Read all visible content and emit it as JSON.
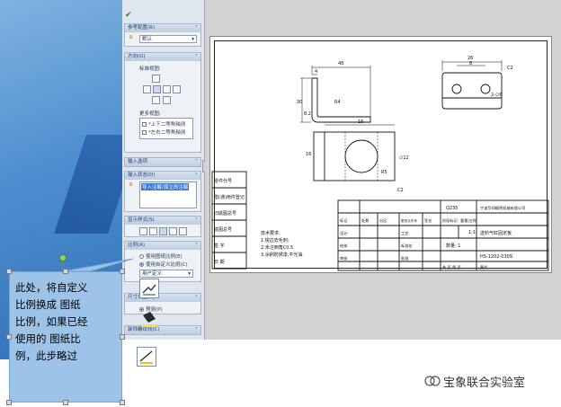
{
  "property_manager": {
    "groups": {
      "reference_config": "参考配置(R)",
      "orientation": "方向(O)",
      "import_options": "输入选项",
      "import_state": "输入状态(D)",
      "display_style": "显示样式(S)",
      "scale": "比例(A)",
      "dimension_type": "尺寸类型(T)",
      "cosmetic_thread": "装饰螺纹线(C)"
    },
    "reference_config_value": "默认",
    "orientation_std_views": "标准视图:",
    "orientation_more_views": "更多视图:",
    "more_views": [
      "*上下二等角轴测",
      "*左右二等角轴测"
    ],
    "import_state_item": "导入注解/孤立的注解",
    "scale_options": [
      "使用图纸比例(E)",
      "使用自定义比例(C)"
    ],
    "scale_custom_value": "用户定义",
    "dimension_option": "预测(P)"
  },
  "drawing": {
    "dims": [
      "48",
      "4",
      "30",
      "8.2",
      "R4",
      "26",
      "8",
      "C2",
      "2-∅6",
      "16",
      "∅12",
      "C2",
      "16",
      "R5"
    ],
    "left_table": [
      "借(通)用件登记",
      "旧底图总号",
      "底图总号",
      "签 字",
      "日 期",
      "零件代号"
    ],
    "tech_notes": [
      "技术要求:",
      "1.锐边去毛刺;",
      "2.未注倒角C0.5",
      "3.涂刷防锈漆,平光油."
    ],
    "title_block": {
      "material": "Q235",
      "company": "宁波华邦精密机械有限公司",
      "part_name": "送料气缸固定板",
      "drawing_no": "HS-1202-0309",
      "count": "数量: 1",
      "scale_ratio": "1:1",
      "header_cells": [
        "阶段标记",
        "重量",
        "比例"
      ],
      "row_labels": [
        "标记",
        "处数",
        "分区",
        "更改文件号",
        "签名",
        "年月日"
      ],
      "roles": [
        "设计",
        "校核",
        "审核",
        "工艺",
        "标准化",
        "批准"
      ],
      "sheets": "共 页 第 页",
      "replaces": "替代"
    }
  },
  "callout": {
    "text": "此处，将自定义\n比例换成  图纸\n比例，如果已经\n使用的  图纸比\n例，此步略过"
  },
  "watermark": "宝象联合实验室"
}
